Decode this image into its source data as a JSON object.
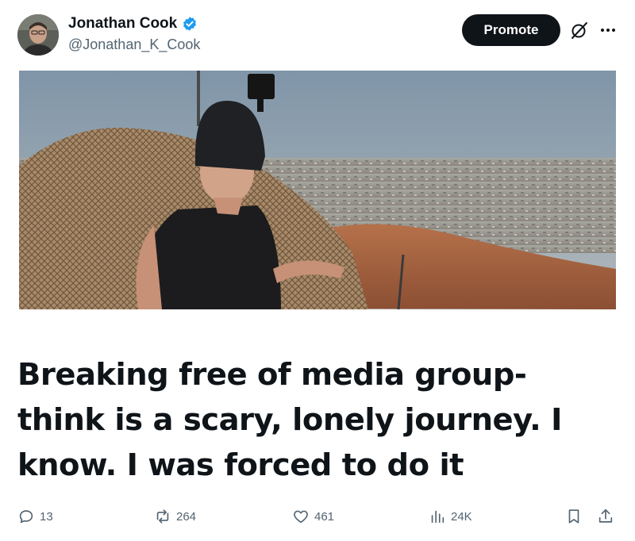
{
  "author": {
    "name": "Jonathan Cook",
    "handle": "@Jonathan_K_Cook",
    "verified": true
  },
  "header": {
    "promote_label": "Promote",
    "icons": [
      "grok-icon",
      "more-icon"
    ]
  },
  "post": {
    "headline": "Breaking free of media group-think is a scary, lonely journey. I know. I was forced to do it",
    "image_description_icon": "media-image"
  },
  "actions": {
    "replies": "13",
    "reposts": "264",
    "likes": "461",
    "views": "24K"
  },
  "colors": {
    "verified_badge": "#1d9bf0",
    "promote_bg": "#0f1419",
    "muted_text": "#536471"
  }
}
